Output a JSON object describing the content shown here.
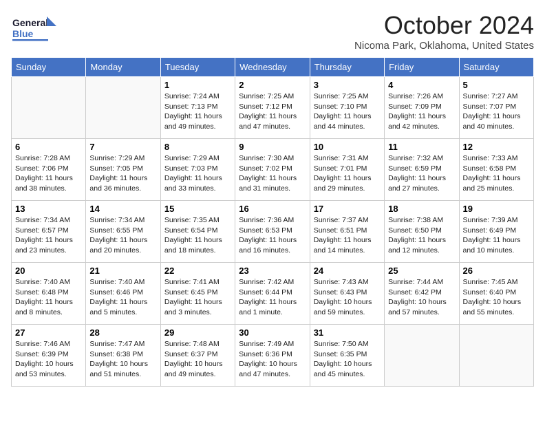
{
  "header": {
    "logo_general": "General",
    "logo_blue": "Blue",
    "title": "October 2024",
    "location": "Nicoma Park, Oklahoma, United States"
  },
  "days_of_week": [
    "Sunday",
    "Monday",
    "Tuesday",
    "Wednesday",
    "Thursday",
    "Friday",
    "Saturday"
  ],
  "weeks": [
    [
      {
        "day": "",
        "sunrise": "",
        "sunset": "",
        "daylight": ""
      },
      {
        "day": "",
        "sunrise": "",
        "sunset": "",
        "daylight": ""
      },
      {
        "day": "1",
        "sunrise": "Sunrise: 7:24 AM",
        "sunset": "Sunset: 7:13 PM",
        "daylight": "Daylight: 11 hours and 49 minutes."
      },
      {
        "day": "2",
        "sunrise": "Sunrise: 7:25 AM",
        "sunset": "Sunset: 7:12 PM",
        "daylight": "Daylight: 11 hours and 47 minutes."
      },
      {
        "day": "3",
        "sunrise": "Sunrise: 7:25 AM",
        "sunset": "Sunset: 7:10 PM",
        "daylight": "Daylight: 11 hours and 44 minutes."
      },
      {
        "day": "4",
        "sunrise": "Sunrise: 7:26 AM",
        "sunset": "Sunset: 7:09 PM",
        "daylight": "Daylight: 11 hours and 42 minutes."
      },
      {
        "day": "5",
        "sunrise": "Sunrise: 7:27 AM",
        "sunset": "Sunset: 7:07 PM",
        "daylight": "Daylight: 11 hours and 40 minutes."
      }
    ],
    [
      {
        "day": "6",
        "sunrise": "Sunrise: 7:28 AM",
        "sunset": "Sunset: 7:06 PM",
        "daylight": "Daylight: 11 hours and 38 minutes."
      },
      {
        "day": "7",
        "sunrise": "Sunrise: 7:29 AM",
        "sunset": "Sunset: 7:05 PM",
        "daylight": "Daylight: 11 hours and 36 minutes."
      },
      {
        "day": "8",
        "sunrise": "Sunrise: 7:29 AM",
        "sunset": "Sunset: 7:03 PM",
        "daylight": "Daylight: 11 hours and 33 minutes."
      },
      {
        "day": "9",
        "sunrise": "Sunrise: 7:30 AM",
        "sunset": "Sunset: 7:02 PM",
        "daylight": "Daylight: 11 hours and 31 minutes."
      },
      {
        "day": "10",
        "sunrise": "Sunrise: 7:31 AM",
        "sunset": "Sunset: 7:01 PM",
        "daylight": "Daylight: 11 hours and 29 minutes."
      },
      {
        "day": "11",
        "sunrise": "Sunrise: 7:32 AM",
        "sunset": "Sunset: 6:59 PM",
        "daylight": "Daylight: 11 hours and 27 minutes."
      },
      {
        "day": "12",
        "sunrise": "Sunrise: 7:33 AM",
        "sunset": "Sunset: 6:58 PM",
        "daylight": "Daylight: 11 hours and 25 minutes."
      }
    ],
    [
      {
        "day": "13",
        "sunrise": "Sunrise: 7:34 AM",
        "sunset": "Sunset: 6:57 PM",
        "daylight": "Daylight: 11 hours and 23 minutes."
      },
      {
        "day": "14",
        "sunrise": "Sunrise: 7:34 AM",
        "sunset": "Sunset: 6:55 PM",
        "daylight": "Daylight: 11 hours and 20 minutes."
      },
      {
        "day": "15",
        "sunrise": "Sunrise: 7:35 AM",
        "sunset": "Sunset: 6:54 PM",
        "daylight": "Daylight: 11 hours and 18 minutes."
      },
      {
        "day": "16",
        "sunrise": "Sunrise: 7:36 AM",
        "sunset": "Sunset: 6:53 PM",
        "daylight": "Daylight: 11 hours and 16 minutes."
      },
      {
        "day": "17",
        "sunrise": "Sunrise: 7:37 AM",
        "sunset": "Sunset: 6:51 PM",
        "daylight": "Daylight: 11 hours and 14 minutes."
      },
      {
        "day": "18",
        "sunrise": "Sunrise: 7:38 AM",
        "sunset": "Sunset: 6:50 PM",
        "daylight": "Daylight: 11 hours and 12 minutes."
      },
      {
        "day": "19",
        "sunrise": "Sunrise: 7:39 AM",
        "sunset": "Sunset: 6:49 PM",
        "daylight": "Daylight: 11 hours and 10 minutes."
      }
    ],
    [
      {
        "day": "20",
        "sunrise": "Sunrise: 7:40 AM",
        "sunset": "Sunset: 6:48 PM",
        "daylight": "Daylight: 11 hours and 8 minutes."
      },
      {
        "day": "21",
        "sunrise": "Sunrise: 7:40 AM",
        "sunset": "Sunset: 6:46 PM",
        "daylight": "Daylight: 11 hours and 5 minutes."
      },
      {
        "day": "22",
        "sunrise": "Sunrise: 7:41 AM",
        "sunset": "Sunset: 6:45 PM",
        "daylight": "Daylight: 11 hours and 3 minutes."
      },
      {
        "day": "23",
        "sunrise": "Sunrise: 7:42 AM",
        "sunset": "Sunset: 6:44 PM",
        "daylight": "Daylight: 11 hours and 1 minute."
      },
      {
        "day": "24",
        "sunrise": "Sunrise: 7:43 AM",
        "sunset": "Sunset: 6:43 PM",
        "daylight": "Daylight: 10 hours and 59 minutes."
      },
      {
        "day": "25",
        "sunrise": "Sunrise: 7:44 AM",
        "sunset": "Sunset: 6:42 PM",
        "daylight": "Daylight: 10 hours and 57 minutes."
      },
      {
        "day": "26",
        "sunrise": "Sunrise: 7:45 AM",
        "sunset": "Sunset: 6:40 PM",
        "daylight": "Daylight: 10 hours and 55 minutes."
      }
    ],
    [
      {
        "day": "27",
        "sunrise": "Sunrise: 7:46 AM",
        "sunset": "Sunset: 6:39 PM",
        "daylight": "Daylight: 10 hours and 53 minutes."
      },
      {
        "day": "28",
        "sunrise": "Sunrise: 7:47 AM",
        "sunset": "Sunset: 6:38 PM",
        "daylight": "Daylight: 10 hours and 51 minutes."
      },
      {
        "day": "29",
        "sunrise": "Sunrise: 7:48 AM",
        "sunset": "Sunset: 6:37 PM",
        "daylight": "Daylight: 10 hours and 49 minutes."
      },
      {
        "day": "30",
        "sunrise": "Sunrise: 7:49 AM",
        "sunset": "Sunset: 6:36 PM",
        "daylight": "Daylight: 10 hours and 47 minutes."
      },
      {
        "day": "31",
        "sunrise": "Sunrise: 7:50 AM",
        "sunset": "Sunset: 6:35 PM",
        "daylight": "Daylight: 10 hours and 45 minutes."
      },
      {
        "day": "",
        "sunrise": "",
        "sunset": "",
        "daylight": ""
      },
      {
        "day": "",
        "sunrise": "",
        "sunset": "",
        "daylight": ""
      }
    ]
  ]
}
